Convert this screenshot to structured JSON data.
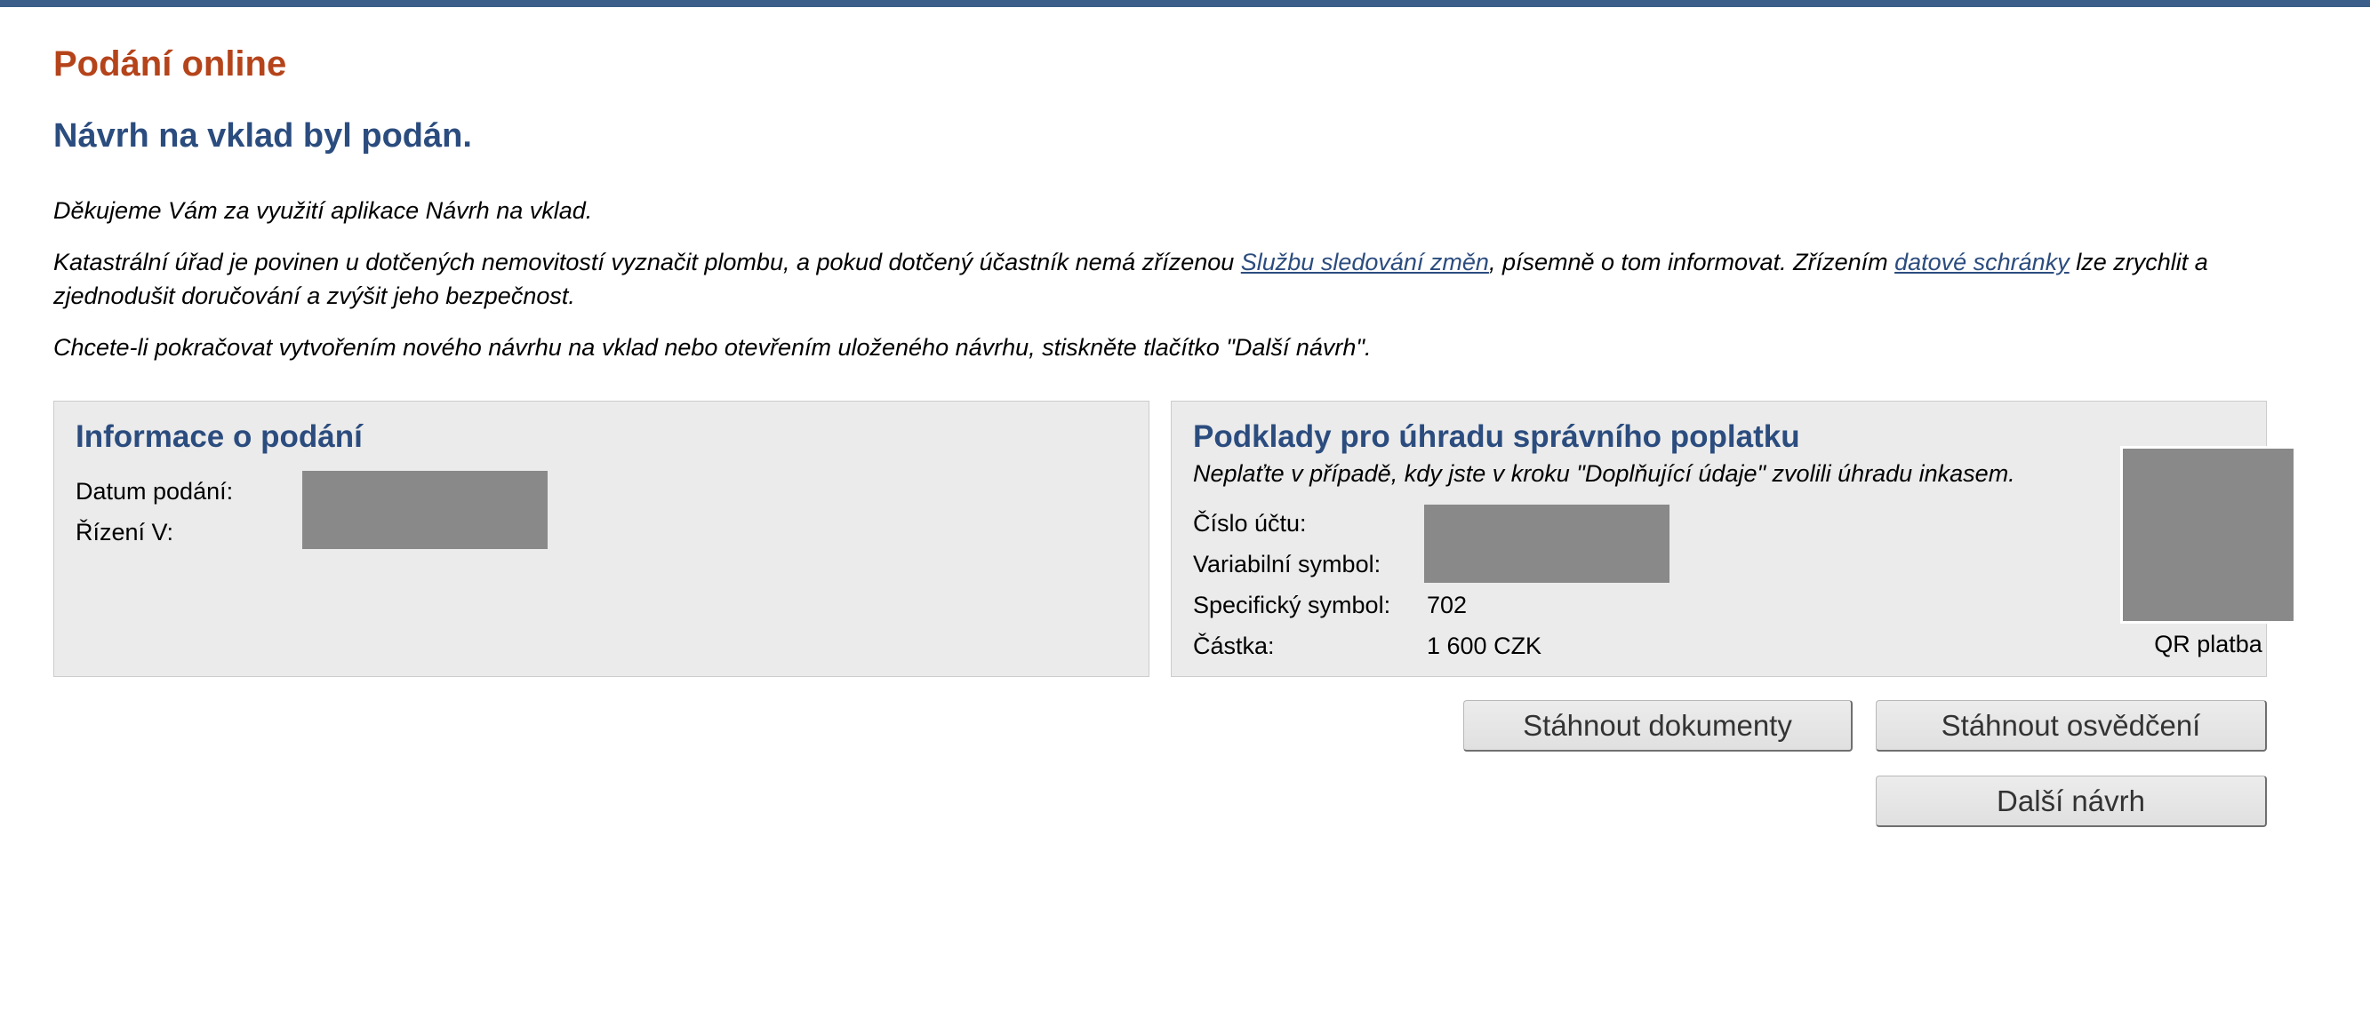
{
  "header": {
    "app_title": "Podání online",
    "page_title": "Návrh na vklad byl podán."
  },
  "messages": {
    "thanks": "Děkujeme Vám za využití aplikace Návrh na vklad.",
    "info_part1": "Katastrální úřad je povinen u dotčených nemovitostí vyznačit plombu, a pokud dotčený účastník nemá zřízenou ",
    "info_link1": "Službu sledování změn",
    "info_part2": ", písemně o tom informovat. Zřízením ",
    "info_link2": "datové schránky",
    "info_part3": " lze zrychlit a zjednodušit doručování a zvýšit jeho bezpečnost.",
    "continue": "Chcete-li pokračovat vytvořením nového návrhu na vklad nebo otevřením uloženého návrhu, stiskněte tlačítko \"Další návrh\"."
  },
  "submission_panel": {
    "heading": "Informace o podání",
    "fields": [
      {
        "label": "Datum podání:"
      },
      {
        "label": "Řízení V:"
      }
    ]
  },
  "payment_panel": {
    "heading": "Podklady pro úhradu správního poplatku",
    "note": "Neplaťte v případě, kdy jste v kroku \"Doplňující údaje\" zvolili úhradu inkasem.",
    "fields": [
      {
        "label": "Číslo účtu:"
      },
      {
        "label": "Variabilní symbol:"
      },
      {
        "label": "Specifický symbol:",
        "value": "702"
      },
      {
        "label": "Částka:",
        "value": "1 600 CZK"
      }
    ],
    "qr_caption": "QR platba"
  },
  "buttons": {
    "download_documents": "Stáhnout dokumenty",
    "download_certificate": "Stáhnout osvědčení",
    "next_proposal": "Další návrh"
  },
  "colors": {
    "top_bar": "#3b5f8a",
    "app_title": "#b5441b",
    "heading": "#2b4c7e",
    "panel_bg": "#ebebeb",
    "redaction": "#898989"
  }
}
